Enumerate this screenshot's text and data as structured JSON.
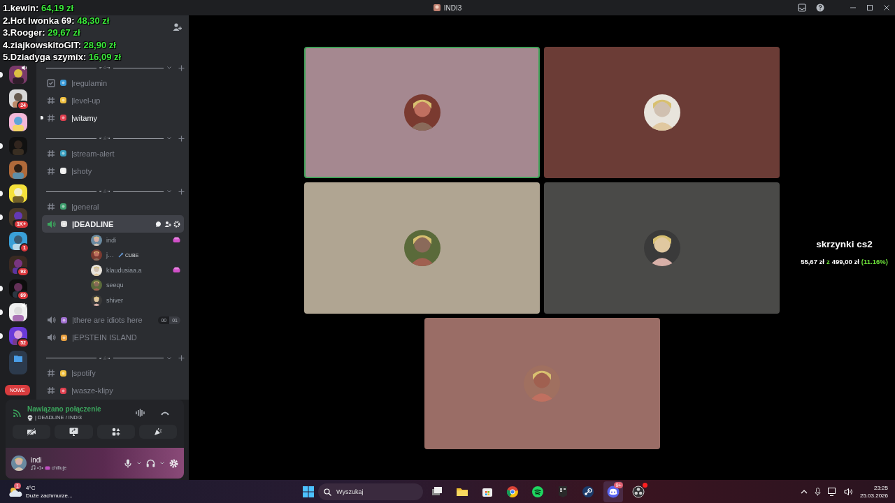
{
  "window": {
    "title": "INDI3"
  },
  "leaderboard": [
    {
      "label": "1.kewin:",
      "amount": "64,19 zł"
    },
    {
      "label": "2.Hot Iwonka 69:",
      "amount": "48,30 zł"
    },
    {
      "label": "3.Rooger:",
      "amount": "29,67 zł"
    },
    {
      "label": "4.ziajkowskitoGIT:",
      "amount": "28,90 zł"
    },
    {
      "label": "5.Dziadyga szymix:",
      "amount": "16,09 zł"
    }
  ],
  "servers": [
    {
      "kind": "server",
      "unread": true,
      "speaker": true
    },
    {
      "kind": "server",
      "unread": false,
      "speaker": false,
      "badge": "24"
    },
    {
      "kind": "server",
      "unread": false,
      "speaker": false
    },
    {
      "kind": "server",
      "unread": true,
      "speaker": false
    },
    {
      "kind": "server",
      "unread": false,
      "speaker": false
    },
    {
      "kind": "server",
      "unread": true,
      "speaker": false
    },
    {
      "kind": "server",
      "unread": true,
      "speaker": false,
      "badge": "1K+"
    },
    {
      "kind": "server",
      "unread": false,
      "speaker": false,
      "badge": "1"
    },
    {
      "kind": "server",
      "unread": false,
      "speaker": false,
      "badge": "93"
    },
    {
      "kind": "server",
      "unread": true,
      "speaker": false,
      "badge": "69"
    },
    {
      "kind": "server",
      "unread": true,
      "speaker": true
    },
    {
      "kind": "server",
      "unread": true,
      "speaker": false,
      "badge": "52"
    },
    {
      "kind": "folder",
      "unread": false,
      "speaker": false
    }
  ],
  "new_pill": "NOWE",
  "channels": [
    {
      "kind": "category",
      "label": "•·☆·•"
    },
    {
      "kind": "rules",
      "name": "|regulamin",
      "unread": false
    },
    {
      "kind": "text",
      "name": "|level-up",
      "unread": false
    },
    {
      "kind": "text",
      "name": "|witamy",
      "unread": true
    },
    {
      "kind": "category",
      "label": "•·☆·•"
    },
    {
      "kind": "text",
      "name": "|stream-alert",
      "unread": false
    },
    {
      "kind": "text",
      "name": "|shoty",
      "unread": false
    },
    {
      "kind": "category",
      "label": "•·☆·•"
    },
    {
      "kind": "text",
      "name": "|general",
      "unread": false
    },
    {
      "kind": "voice",
      "name": "|DEADLINE",
      "selected": true,
      "connected": true,
      "members": [
        {
          "name": "indi",
          "activity": true
        },
        {
          "name": "j…",
          "tag": "CUBE",
          "activity": false
        },
        {
          "name": "klaudusiaa.a",
          "activity": true
        },
        {
          "name": "seequ",
          "activity": false
        },
        {
          "name": "shiver",
          "activity": false
        }
      ]
    },
    {
      "kind": "voice",
      "name": "|there are idiots here",
      "selected": false,
      "connected": false,
      "counts": [
        "00",
        "01"
      ]
    },
    {
      "kind": "voice",
      "name": "|EPSTEIN ISLAND",
      "selected": false,
      "connected": false
    },
    {
      "kind": "category",
      "label": "•·☆·•"
    },
    {
      "kind": "text",
      "name": "|spotify",
      "unread": false
    },
    {
      "kind": "text",
      "name": "|wasze-klipy",
      "unread": false
    }
  ],
  "voice_panel": {
    "status": "Nawiązano połączenie",
    "location": "| DEADLINE / INDI3"
  },
  "user": {
    "name": "indi",
    "activity": "•1•",
    "status": "chilluje"
  },
  "tiles": [
    {
      "color": "#a58890",
      "speaking": true
    },
    {
      "color": "#6b3c36",
      "speaking": false
    },
    {
      "color": "#b0a592",
      "speaking": false
    },
    {
      "color": "#4a4a48",
      "speaking": false
    },
    {
      "color": "#9a6d66",
      "speaking": false
    }
  ],
  "goal": {
    "title": "skrzynki cs2",
    "current": "55,67 zł",
    "separator": "z",
    "target": "499,00 zł",
    "percent": "(11.16%)"
  },
  "taskbar": {
    "weather": {
      "temp": "4°C",
      "desc": "Duże zachmurze...",
      "badge": "1"
    },
    "search": {
      "placeholder": "Wyszukaj"
    },
    "apps": [
      {
        "kind": "taskview",
        "active": false
      },
      {
        "kind": "files",
        "active": false
      },
      {
        "kind": "store",
        "active": false
      },
      {
        "kind": "chrome",
        "active": false
      },
      {
        "kind": "spotify",
        "active": false
      },
      {
        "kind": "epic",
        "active": false
      },
      {
        "kind": "steam",
        "active": false
      },
      {
        "kind": "discord",
        "active": true,
        "badge": "9+"
      },
      {
        "kind": "obs",
        "active": false,
        "alert": true
      }
    ],
    "time": "23:25",
    "date": "25.03.2026"
  }
}
